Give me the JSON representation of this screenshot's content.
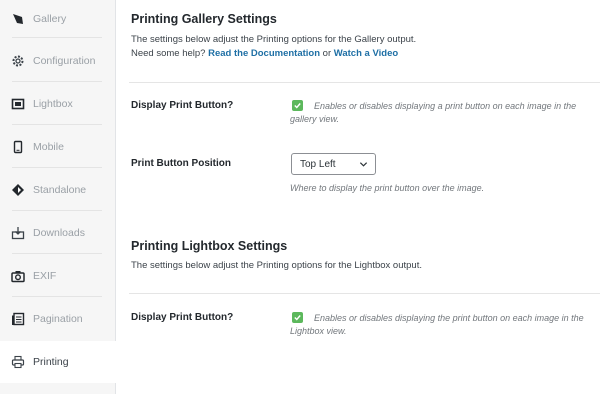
{
  "sidebar": {
    "items": [
      {
        "label": "Gallery",
        "icon": "leaf-icon"
      },
      {
        "label": "Configuration",
        "icon": "gear-icon"
      },
      {
        "label": "Lightbox",
        "icon": "lightbox-icon"
      },
      {
        "label": "Mobile",
        "icon": "mobile-icon"
      },
      {
        "label": "Standalone",
        "icon": "standalone-icon"
      },
      {
        "label": "Downloads",
        "icon": "downloads-icon"
      },
      {
        "label": "EXIF",
        "icon": "camera-icon"
      },
      {
        "label": "Pagination",
        "icon": "pagination-icon"
      },
      {
        "label": "Printing",
        "icon": "printer-icon",
        "active": true
      }
    ]
  },
  "gallery_section": {
    "title": "Printing Gallery Settings",
    "desc_line1": "The settings below adjust the Printing options for the Gallery output.",
    "help_prefix": "Need some help?",
    "docs_link": "Read the Documentation",
    "or_text": "or",
    "video_link": "Watch a Video",
    "print_button": {
      "label": "Display Print Button?",
      "checked": true,
      "help": "Enables or disables displaying a print button on each image in the gallery view."
    },
    "position": {
      "label": "Print Button Position",
      "value": "Top Left",
      "help": "Where to display the print button over the image."
    }
  },
  "lightbox_section": {
    "title": "Printing Lightbox Settings",
    "desc": "The settings below adjust the Printing options for the Lightbox output.",
    "print_button": {
      "label": "Display Print Button?",
      "checked": true,
      "help": "Enables or disables displaying the print button on each image in the Lightbox view."
    }
  },
  "colors": {
    "accent_link": "#1e6fa5",
    "checkbox_green": "#5cb85c"
  }
}
